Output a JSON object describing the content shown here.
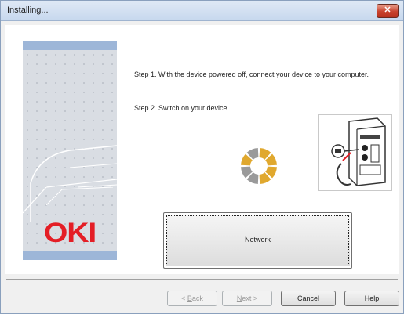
{
  "window": {
    "title": "Installing..."
  },
  "sidebar": {
    "brand": "OKI"
  },
  "steps": [
    {
      "text": "Step 1. With the device powered off, connect your device to your computer."
    },
    {
      "text": "Step 2. Switch on your device."
    }
  ],
  "main": {
    "network_button": "Network"
  },
  "footer": {
    "back": {
      "label": "Back",
      "prefix": "< ",
      "mnemonic": "B",
      "rest": "ack",
      "enabled": false
    },
    "next": {
      "label": "Next",
      "mnemonic": "N",
      "rest": "ext",
      "suffix": " >",
      "enabled": false
    },
    "cancel": "Cancel",
    "help": "Help"
  },
  "colors": {
    "brand": "#e41e26",
    "spinner_active": "#e0a82e",
    "spinner_inactive": "#9a9a9a",
    "sidebar_band": "#9db6d8"
  },
  "icons": {
    "close": "close-icon",
    "spinner": "loading-spinner-icon",
    "device": "device-connection-illustration"
  }
}
